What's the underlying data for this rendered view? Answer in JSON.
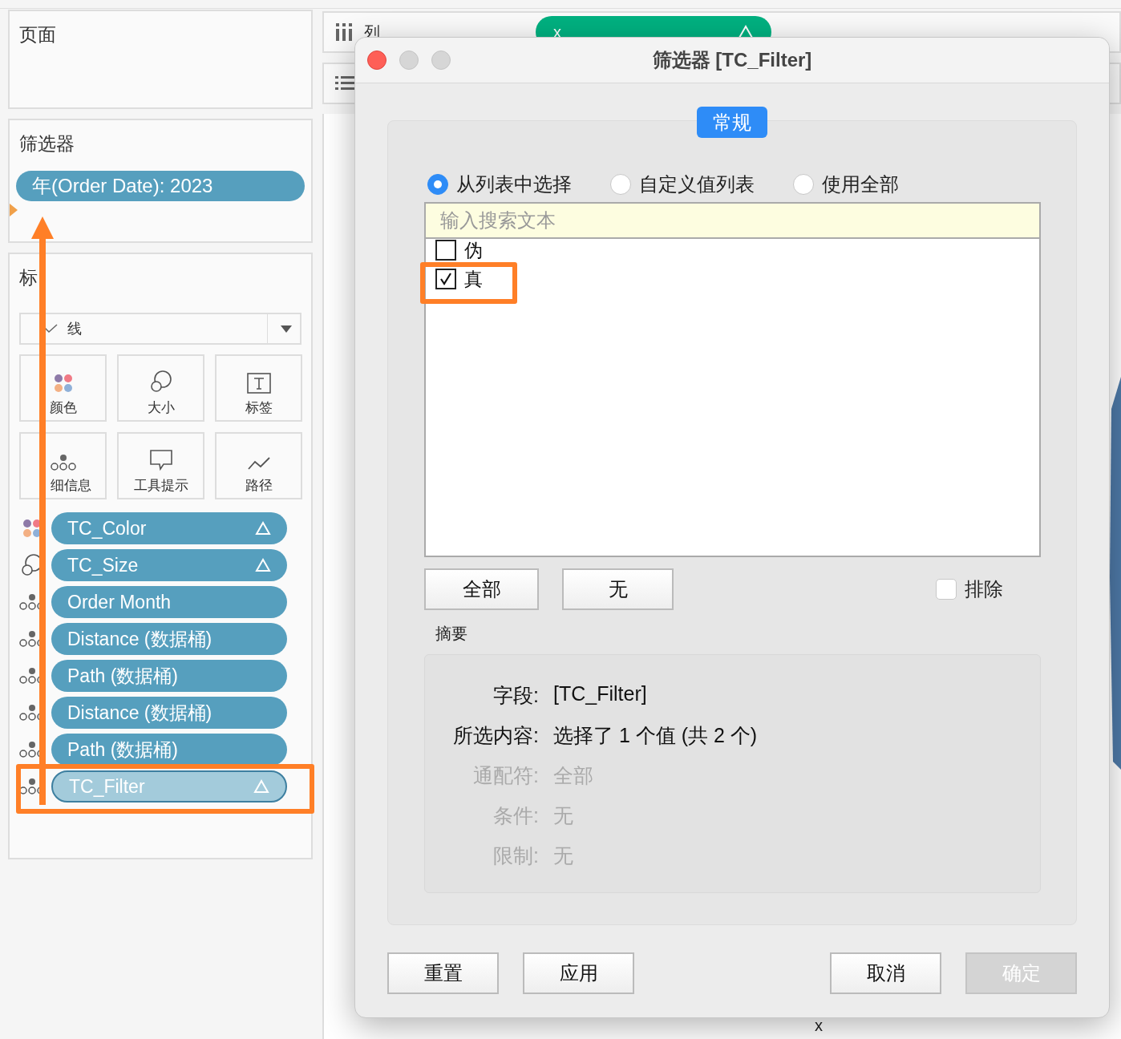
{
  "pages_card": {
    "title": "页面"
  },
  "filters_card": {
    "title": "筛选器",
    "pills": [
      {
        "label": "年(Order Date): 2023"
      }
    ]
  },
  "marks_card": {
    "title": "标",
    "mark_type": "线",
    "buttons": [
      {
        "label": "颜色",
        "kind": "color"
      },
      {
        "label": "大小",
        "kind": "size"
      },
      {
        "label": "标签",
        "kind": "label"
      },
      {
        "label": "细信息",
        "kind": "detail"
      },
      {
        "label": "工具提示",
        "kind": "tooltip"
      },
      {
        "label": "路径",
        "kind": "path"
      }
    ],
    "fields": [
      {
        "label": "TC_Color",
        "kind": "color",
        "delta": true,
        "selected": false
      },
      {
        "label": "TC_Size",
        "kind": "size",
        "delta": true,
        "selected": false
      },
      {
        "label": "Order Month",
        "kind": "detail",
        "delta": false,
        "selected": false
      },
      {
        "label": "Distance (数据桶)",
        "kind": "detail",
        "delta": false,
        "selected": false
      },
      {
        "label": "Path (数据桶)",
        "kind": "detail",
        "delta": false,
        "selected": false
      },
      {
        "label": "Distance (数据桶)",
        "kind": "detail",
        "delta": false,
        "selected": false
      },
      {
        "label": "Path (数据桶)",
        "kind": "detail",
        "delta": false,
        "selected": false
      },
      {
        "label": "TC_Filter",
        "kind": "detail",
        "delta": true,
        "selected": true
      }
    ]
  },
  "columns_shelf": {
    "label": "列",
    "pill": {
      "label": "x",
      "delta": true
    }
  },
  "axis_label": "x",
  "dialog": {
    "title": "筛选器 [TC_Filter]",
    "tab": "常规",
    "modes": [
      {
        "label": "从列表中选择",
        "selected": true
      },
      {
        "label": "自定义值列表",
        "selected": false
      },
      {
        "label": "使用全部",
        "selected": false
      }
    ],
    "search": {
      "placeholder": "输入搜索文本"
    },
    "values": [
      {
        "label": "伪",
        "checked": false
      },
      {
        "label": "真",
        "checked": true
      }
    ],
    "all_button": "全部",
    "none_button": "无",
    "exclude": {
      "label": "排除",
      "checked": false
    },
    "summary_title": "摘要",
    "summary": [
      {
        "label": "字段:",
        "value": "[TC_Filter]",
        "disabled": false
      },
      {
        "label": "所选内容:",
        "value": "选择了 1 个值 (共 2 个)",
        "disabled": false
      },
      {
        "label": "通配符:",
        "value": "全部",
        "disabled": true
      },
      {
        "label": "条件:",
        "value": "无",
        "disabled": true
      },
      {
        "label": "限制:",
        "value": "无",
        "disabled": true
      }
    ],
    "footer_buttons": [
      {
        "label": "重置",
        "disabled": false
      },
      {
        "label": "应用",
        "disabled": false
      },
      {
        "label": "取消",
        "disabled": false
      },
      {
        "label": "确定",
        "disabled": true
      }
    ]
  }
}
